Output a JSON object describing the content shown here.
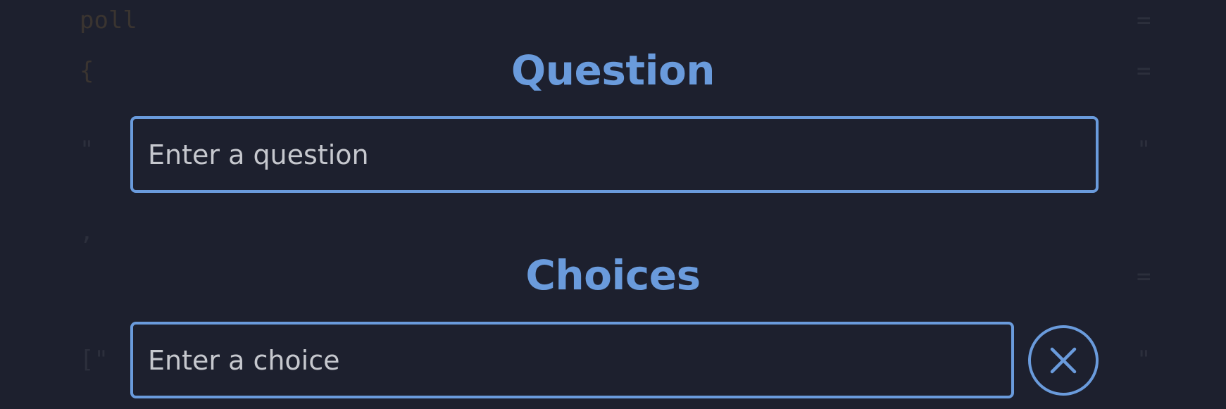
{
  "colors": {
    "background": "#1d202e",
    "accent": "#6a9bdc",
    "placeholder": "#c6c8ce"
  },
  "background_code": {
    "line1": "poll",
    "line2": "{",
    "line3": "\"",
    "line4": ",",
    "line5": "[\"",
    "right1": "=",
    "right2": "=",
    "right3": "\"",
    "right4": "=",
    "right5": "\""
  },
  "question": {
    "title": "Question",
    "placeholder": "Enter a question"
  },
  "choices": {
    "title": "Choices",
    "items": [
      {
        "placeholder": "Enter a choice",
        "remove_icon": "close-icon"
      }
    ]
  }
}
